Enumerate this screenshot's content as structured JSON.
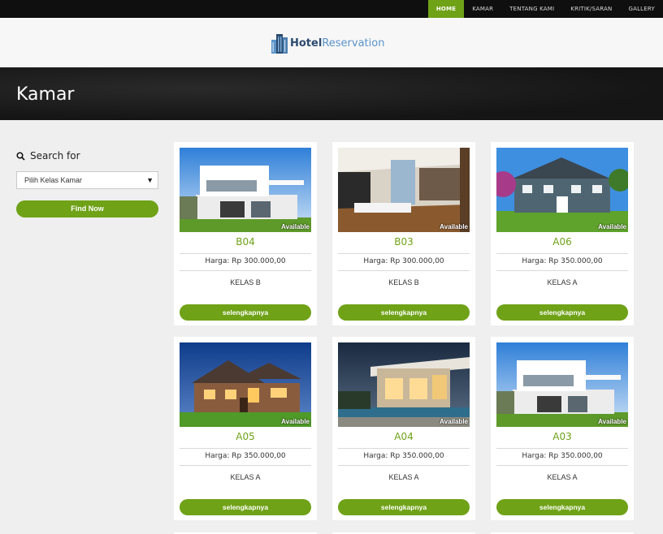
{
  "nav": {
    "items": [
      {
        "label": "HOME"
      },
      {
        "label": "KAMAR"
      },
      {
        "label": "TENTANG KAMI"
      },
      {
        "label": "KRITIK/SARAN"
      },
      {
        "label": "GALLERY"
      }
    ]
  },
  "logo": {
    "part1": "Hotel",
    "part2": "Reservation"
  },
  "banner": {
    "title": "Kamar"
  },
  "sidebar": {
    "search_label": "Search for",
    "select_value": "Pilih Kelas Kamar",
    "find_button": "Find Now"
  },
  "rooms": [
    {
      "code": "B04",
      "status": "Available",
      "price": "Harga: Rp 300.000,00",
      "kelas": "KELAS B",
      "button": "selengkapnya",
      "image": "modern-white-house"
    },
    {
      "code": "B03",
      "status": "Available",
      "price": "Harga: Rp 300.000,00",
      "kelas": "KELAS B",
      "button": "selengkapnya",
      "image": "interior-living-room"
    },
    {
      "code": "A06",
      "status": "Available",
      "price": "Harga: Rp 350.000,00",
      "kelas": "KELAS A",
      "button": "selengkapnya",
      "image": "colonial-house"
    },
    {
      "code": "A05",
      "status": "Available",
      "price": "Harga: Rp 350.000,00",
      "kelas": "KELAS A",
      "button": "selengkapnya",
      "image": "night-brick-house"
    },
    {
      "code": "A04",
      "status": "Available",
      "price": "Harga: Rp 350.000,00",
      "kelas": "KELAS A",
      "button": "selengkapnya",
      "image": "pool-house"
    },
    {
      "code": "A03",
      "status": "Available",
      "price": "Harga: Rp 350.000,00",
      "kelas": "KELAS A",
      "button": "selengkapnya",
      "image": "modern-white-house"
    }
  ]
}
